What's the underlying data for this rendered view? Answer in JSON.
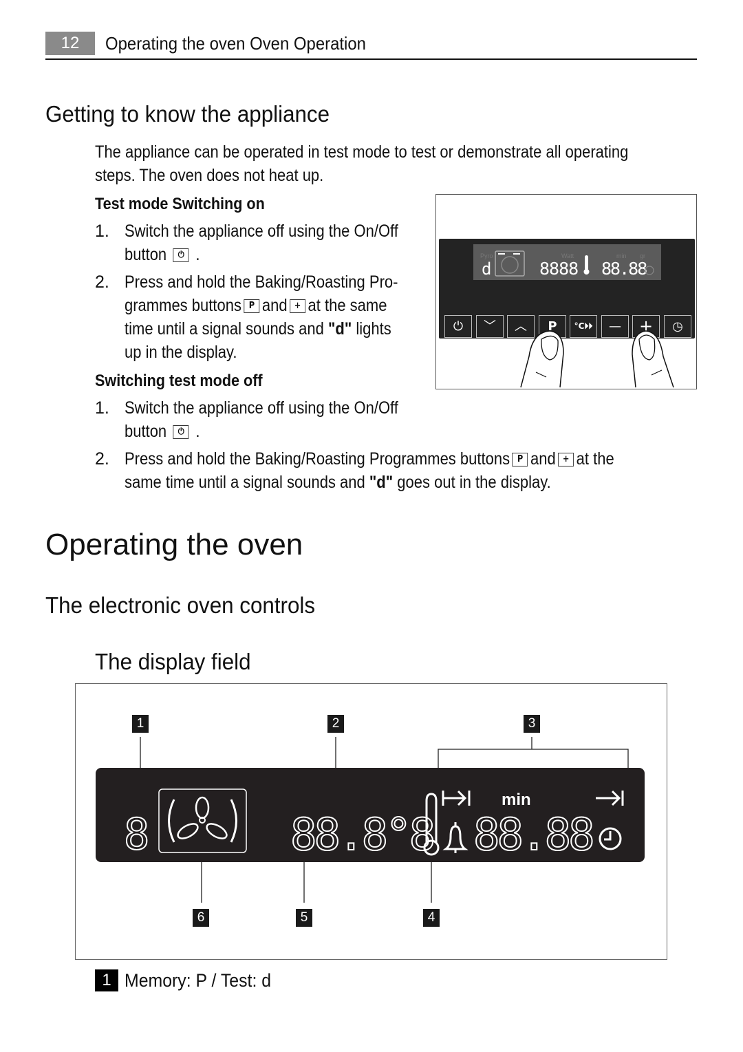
{
  "header": {
    "page_number": "12",
    "running_title": "Operating the oven Oven Operation"
  },
  "section_getting_to_know": {
    "title": "Getting to know the appliance",
    "intro_line1": "The appliance can be operated in test mode to test or demonstrate all operating",
    "intro_line2": "steps. The oven does not heat up.",
    "test_on": {
      "heading": "Test mode Switching on",
      "steps": [
        {
          "num": "1.",
          "line1": "Switch the appliance off using the On/Off",
          "line2_pre": "button",
          "line2_post": "."
        },
        {
          "num": "2.",
          "line1": "Press and hold the Baking/Roasting Pro-",
          "line2_pre": "grammes buttons",
          "line2_mid": "and",
          "line2_post": "at the same",
          "line3_pre": "time until a signal sounds and",
          "line3_bold": "\"d\"",
          "line3_post": "lights",
          "line4": "up in the display."
        }
      ]
    },
    "test_off": {
      "heading": "Switching test mode off",
      "steps": [
        {
          "num": "1.",
          "line1": "Switch the appliance off using the On/Off",
          "line2_pre": "button",
          "line2_post": "."
        },
        {
          "num": "2.",
          "line1_pre": "Press and hold the Baking/Roasting Programmes buttons",
          "line1_mid": "and",
          "line1_post": "at the",
          "line2_pre": "same time until a signal sounds and",
          "line2_bold": "\"d\"",
          "line2_post": "goes out in the display."
        }
      ]
    }
  },
  "key_icons": {
    "onoff": "power-icon",
    "programme": "P",
    "plus": "+"
  },
  "control_panel_figure": {
    "display_char": "d",
    "display_labels": [
      "Pyro",
      "Watt",
      "min",
      "gr"
    ],
    "display_digits_left": "8888",
    "display_digits_right": "88.88",
    "buttons": [
      {
        "name": "on-off",
        "glyph": "⏻"
      },
      {
        "name": "down",
        "glyph": "﹀"
      },
      {
        "name": "up",
        "glyph": "︿"
      },
      {
        "name": "programme",
        "glyph": "P"
      },
      {
        "name": "rapid-heat",
        "glyph": "°C⏵⏵"
      },
      {
        "name": "minus",
        "glyph": "—"
      },
      {
        "name": "plus",
        "glyph": "+"
      },
      {
        "name": "clock",
        "glyph": "◷"
      }
    ]
  },
  "section_operating": {
    "title": "Operating the oven",
    "subtitle": "The electronic oven controls",
    "subsubtitle": "The display field"
  },
  "display_field_figure": {
    "callouts": [
      "1",
      "2",
      "3",
      "4",
      "5",
      "6"
    ],
    "digit_left": "8",
    "digits_temp": "88.8°8",
    "digits_time": "88.88",
    "label_min": "min",
    "icons": [
      "fan-icon",
      "thermometer-icon",
      "duration-icon",
      "end-time-icon",
      "bell-icon",
      "clock-icon"
    ]
  },
  "legend": [
    {
      "num": "1",
      "text": "Memory: P / Test: d"
    }
  ]
}
